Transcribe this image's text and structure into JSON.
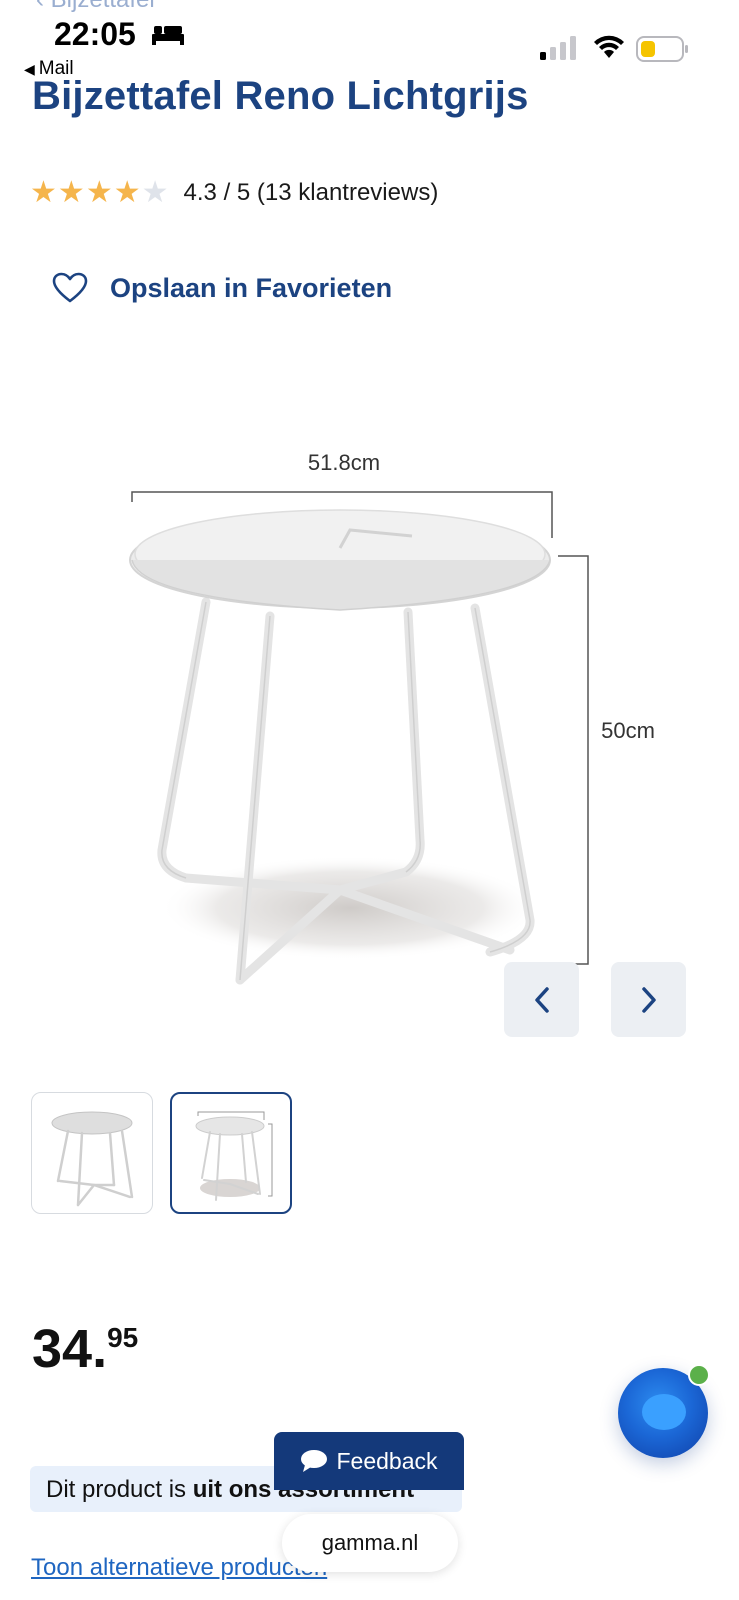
{
  "status_bar": {
    "breadcrumb_back": "Bijzettafel",
    "time": "22:05",
    "back_app": "Mail",
    "icons": [
      "bed-icon",
      "signal-icon",
      "wifi-icon",
      "battery-icon"
    ],
    "battery_color": "#f5c400"
  },
  "product": {
    "title": "Bijzettafel Reno Lichtgrijs",
    "rating_value": 4.3,
    "rating_max": 5,
    "rating_text": "4.3 / 5 (13 klantreviews)",
    "stars": [
      "on",
      "on",
      "on",
      "on",
      "off"
    ],
    "favorite_label": "Opslaan in Favorieten",
    "image": {
      "width_label": "51.8cm",
      "height_label": "50cm"
    },
    "thumbnails_count": 2,
    "active_thumbnail": 2,
    "price_whole": "34",
    "price_dot": ".",
    "price_cents": "95"
  },
  "notice": {
    "prefix": "Dit product is ",
    "bold": "uit ons assortiment"
  },
  "feedback_label": "Feedback",
  "alternatives_link": "Toon alternatieve producten",
  "url": "gamma.nl",
  "colors": {
    "brand_blue": "#1c4381",
    "star": "#f5b54c",
    "link": "#1f66c1",
    "notice_bg": "#e8f0fb",
    "feedback_bg": "#14397a"
  }
}
